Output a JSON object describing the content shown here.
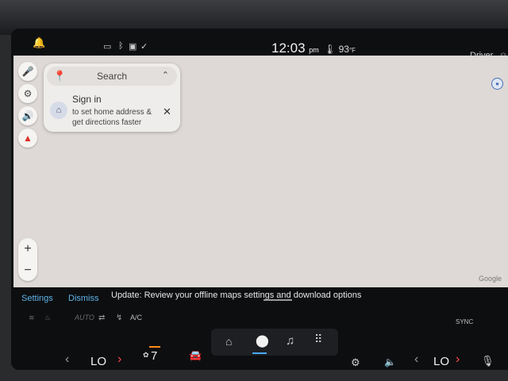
{
  "status_bar": {
    "time": "12:03",
    "ampm": "pm",
    "temperature": "93",
    "temp_unit": "°F",
    "profile": "Driver"
  },
  "map": {
    "search_label": "Search",
    "signin_title": "Sign in",
    "signin_subtitle": "to set home address & get directions faster",
    "attribution": "Google"
  },
  "notice": {
    "settings_label": "Settings",
    "dismiss_label": "Dismiss",
    "message": "Update: Review your offline maps settings and download options"
  },
  "dock": {
    "auto_label": "AUTO",
    "ac_label": "A/C",
    "sync_label": "SYNC",
    "left_temp": "LO",
    "right_temp": "LO",
    "fan_speed": "7"
  },
  "icons": {
    "bell": "bell-icon",
    "mic": "mic-icon",
    "settings": "gear-icon",
    "volume": "volume-icon",
    "compass": "compass-icon",
    "home": "home-icon",
    "apps": "apps-grid-icon",
    "music": "music-note-icon",
    "nav": "navigation-pin-icon"
  },
  "colors": {
    "accent_link": "#5fb4e8",
    "map_bg": "#ded9d6",
    "pin_red": "#d93025",
    "heat_orange": "#ff8c1a"
  }
}
